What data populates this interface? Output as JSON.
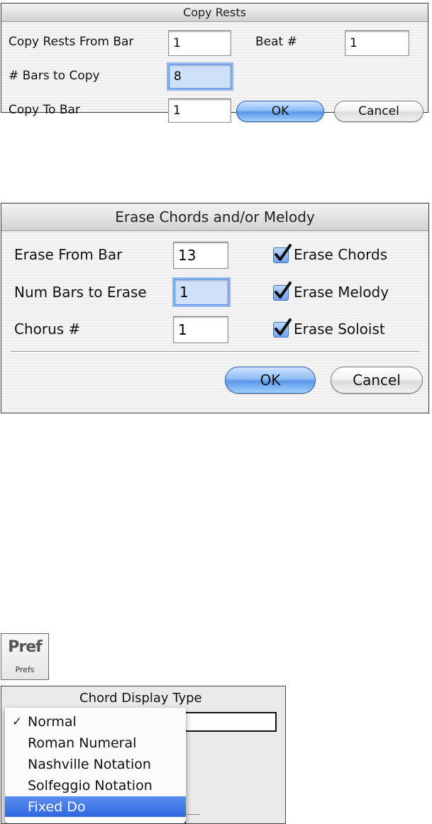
{
  "copy_rests": {
    "title": "Copy Rests",
    "from_bar_label": "Copy Rests From Bar",
    "from_bar_value": "1",
    "beat_label": "Beat #",
    "beat_value": "1",
    "bars_to_copy_label": "# Bars to Copy",
    "bars_to_copy_value": "8",
    "copy_to_label": "Copy To Bar",
    "copy_to_value": "1",
    "ok_label": "OK",
    "cancel_label": "Cancel"
  },
  "erase_dialog": {
    "title": "Erase Chords and/or Melody",
    "from_bar_label": "Erase From Bar",
    "from_bar_value": "13",
    "num_bars_label": "Num Bars to Erase",
    "num_bars_value": "1",
    "chorus_label": "Chorus #",
    "chorus_value": "1",
    "erase_chords_label": "Erase Chords",
    "erase_chords_checked": true,
    "erase_melody_label": "Erase Melody",
    "erase_melody_checked": true,
    "erase_soloist_label": "Erase Soloist",
    "erase_soloist_checked": true,
    "ok_label": "OK",
    "cancel_label": "Cancel"
  },
  "prefs_button": {
    "icon_text": "Pref",
    "label": "Prefs"
  },
  "chord_display": {
    "title": "Chord Display Type",
    "options": [
      {
        "label": "Normal",
        "checked": true,
        "highlighted": false
      },
      {
        "label": "Roman Numeral",
        "checked": false,
        "highlighted": false
      },
      {
        "label": "Nashville Notation",
        "checked": false,
        "highlighted": false
      },
      {
        "label": "Solfeggio Notation",
        "checked": false,
        "highlighted": false
      },
      {
        "label": "Fixed Do",
        "checked": false,
        "highlighted": true
      }
    ]
  },
  "colors": {
    "default_button": "#5a97e8",
    "focus_ring": "#8fb6ee",
    "menu_highlight": "#2f67df"
  }
}
